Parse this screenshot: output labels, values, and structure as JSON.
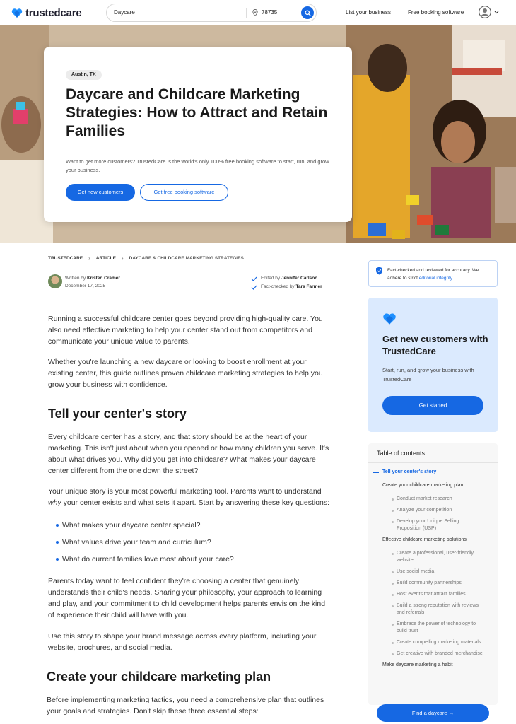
{
  "brand": {
    "name": "trustedcare",
    "accent": "#1668e3"
  },
  "search": {
    "query": "Daycare",
    "zip": "78735"
  },
  "nav": {
    "list_business": "List your business",
    "free_booking": "Free booking software"
  },
  "hero": {
    "location": "Austin, TX",
    "title": "Daycare and Childcare Marketing Strategies: How to Attract and Retain Families",
    "subtitle": "Want to get more customers? TrustedCare is the world's only 100% free booking software to start, run, and grow your business.",
    "primary_button": "Get new customers",
    "secondary_button": "Get free booking software"
  },
  "breadcrumb": [
    "TRUSTEDCARE",
    "ARTICLE",
    "DAYCARE & CHILDCARE MARKETING STRATEGIES"
  ],
  "author": {
    "written_by_label": "Written by",
    "name": "Kristen Cramer",
    "date": "December 17, 2025"
  },
  "editors": {
    "edited_label": "Edited by",
    "edited_name": "Jennifer Carlson",
    "checked_label": "Fact-checked by",
    "checked_name": "Tara Farmer"
  },
  "article": {
    "p1": "Running a successful childcare center goes beyond providing high-quality care. You also need effective marketing to help your center stand out from competitors and communicate your unique value to parents.",
    "p2": "Whether you're launching a new daycare or looking to boost enrollment at your existing center, this guide outlines proven childcare marketing strategies to help you grow your business with confidence.",
    "h1": "Tell your center's story",
    "p3": "Every childcare center has a story, and that story should be at the heart of your marketing. This isn't just about when you opened or how many children you serve. It's about what drives you. Why did you get into childcare? What makes your daycare center different from the one down the street?",
    "p4_a": "Your unique story is your most powerful marketing tool. Parents want to understand",
    "p4_em": "why",
    "p4_b": "your center exists and what sets it apart. Start by answering these key questions:",
    "bullets": [
      "What makes your daycare center special?",
      "What values drive your team and curriculum?",
      "What do current families love most about your care?"
    ],
    "p5": "Parents today want to feel confident they're choosing a center that genuinely understands their child's needs. Sharing your philosophy, your approach to learning and play, and your commitment to child development helps parents envision the kind of experience their child will have with you.",
    "p6": "Use this story to shape your brand message across every platform, including your website, brochures, and social media.",
    "h2": "Create your childcare marketing plan",
    "p7": "Before implementing marketing tactics, you need a comprehensive plan that outlines your goals and strategies. Don't skip these three essential steps:"
  },
  "fact_check": {
    "text": "Fact-checked and reviewed for accuracy. We adhere to strict",
    "link": "editorial integrity",
    "end": "."
  },
  "promo": {
    "title": "Get new customers with TrustedCare",
    "subtitle": "Start, run, and grow your business with TrustedCare",
    "button": "Get started"
  },
  "toc": {
    "heading": "Table of contents",
    "items": [
      {
        "label": "Tell your center's story",
        "level": 1,
        "active": true
      },
      {
        "label": "Create your childcare marketing plan",
        "level": 1
      },
      {
        "label": "Conduct market research",
        "level": 2
      },
      {
        "label": "Analyze your competition",
        "level": 2
      },
      {
        "label": "Develop your Unique Selling Proposition (USP)",
        "level": 2
      },
      {
        "label": "Effective childcare marketing solutions",
        "level": 1
      },
      {
        "label": "Create a professional, user-friendly website",
        "level": 2
      },
      {
        "label": "Use social media",
        "level": 2
      },
      {
        "label": "Build community partnerships",
        "level": 2
      },
      {
        "label": "Host events that attract families",
        "level": 2
      },
      {
        "label": "Build a strong reputation with reviews and referrals",
        "level": 2
      },
      {
        "label": "Embrace the power of technology to build trust",
        "level": 2
      },
      {
        "label": "Create compelling marketing materials",
        "level": 2
      },
      {
        "label": "Get creative with branded merchandise",
        "level": 2
      },
      {
        "label": "Make daycare marketing a habit",
        "level": 1
      }
    ]
  },
  "find_button": "Find a daycare"
}
